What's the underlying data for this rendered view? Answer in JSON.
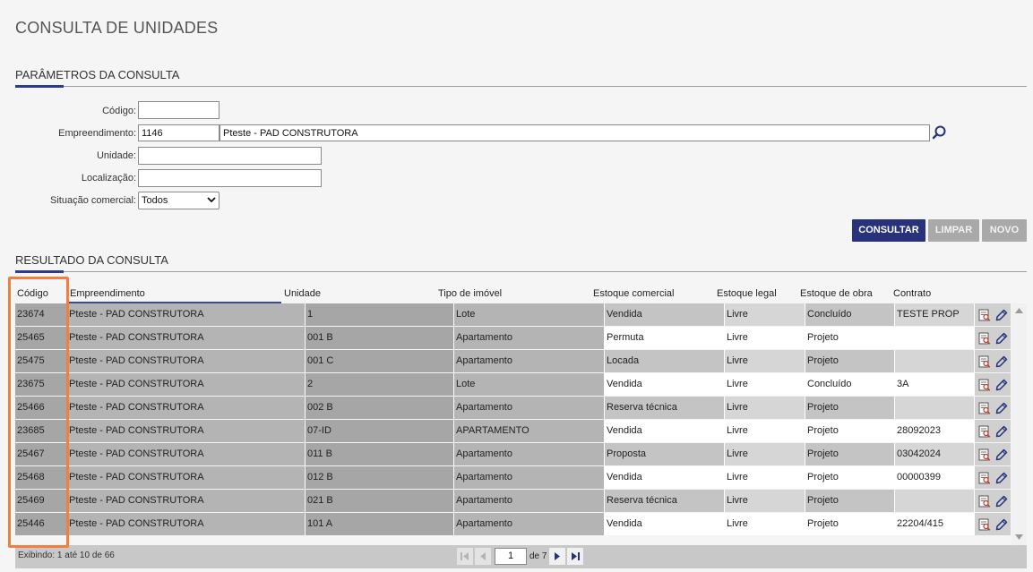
{
  "page": {
    "title": "CONSULTA DE UNIDADES"
  },
  "params": {
    "title": "PARÂMETROS DA CONSULTA",
    "codigo_label": "Código:",
    "codigo_value": "",
    "empreendimento_label": "Empreendimento:",
    "empreendimento_code": "1146",
    "empreendimento_name": "Pteste - PAD CONSTRUTORA",
    "unidade_label": "Unidade:",
    "unidade_value": "",
    "localizacao_label": "Localização:",
    "localizacao_value": "",
    "situacao_label": "Situação comercial:",
    "situacao_value": "Todos"
  },
  "actions": {
    "consultar": "CONSULTAR",
    "limpar": "LIMPAR",
    "novo": "NOVO"
  },
  "results": {
    "title": "RESULTADO DA CONSULTA",
    "headers": [
      "Código",
      "Empreendimento",
      "Unidade",
      "Tipo de imóvel",
      "Estoque comercial",
      "Estoque legal",
      "Estoque de obra",
      "Contrato"
    ],
    "rows": [
      [
        "23674",
        "Pteste - PAD CONSTRUTORA",
        "1",
        "Lote",
        "Vendida",
        "Livre",
        "Concluído",
        "TESTE PROP"
      ],
      [
        "25465",
        "Pteste - PAD CONSTRUTORA",
        "001 B",
        "Apartamento",
        "Permuta",
        "Livre",
        "Projeto",
        ""
      ],
      [
        "25475",
        "Pteste - PAD CONSTRUTORA",
        "001 C",
        "Apartamento",
        "Locada",
        "Livre",
        "Projeto",
        ""
      ],
      [
        "23675",
        "Pteste - PAD CONSTRUTORA",
        "2",
        "Lote",
        "Vendida",
        "Livre",
        "Concluído",
        "3A"
      ],
      [
        "25466",
        "Pteste - PAD CONSTRUTORA",
        "002 B",
        "Apartamento",
        "Reserva técnica",
        "Livre",
        "Projeto",
        ""
      ],
      [
        "23685",
        "Pteste - PAD CONSTRUTORA",
        "07-ID",
        "APARTAMENTO",
        "Vendida",
        "Livre",
        "Projeto",
        "28092023"
      ],
      [
        "25467",
        "Pteste - PAD CONSTRUTORA",
        "011 B",
        "Apartamento",
        "Proposta",
        "Livre",
        "Projeto",
        "03042024"
      ],
      [
        "25468",
        "Pteste - PAD CONSTRUTORA",
        "012 B",
        "Apartamento",
        "Vendida",
        "Livre",
        "Projeto",
        "00000399"
      ],
      [
        "25469",
        "Pteste - PAD CONSTRUTORA",
        "021 B",
        "Apartamento",
        "Reserva técnica",
        "Livre",
        "Projeto",
        ""
      ],
      [
        "25446",
        "Pteste - PAD CONSTRUTORA",
        "101 A",
        "Apartamento",
        "Vendida",
        "Livre",
        "Projeto",
        "22204/415"
      ]
    ]
  },
  "pagination": {
    "summary": "Exibindo: 1 até 10 de 66",
    "current_page": "1",
    "of_label": "de 7"
  },
  "colors": {
    "primary": "#27327a",
    "highlight": "#f27f3d",
    "row_dark": "#a6a6a6",
    "row_light": "#ffffff",
    "row_mid": "#c4c4c4"
  }
}
